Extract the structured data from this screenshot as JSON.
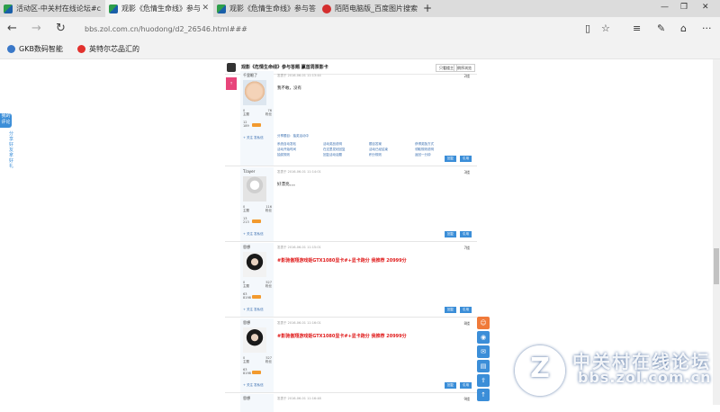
{
  "tabs": [
    {
      "label": "活动区-中关村在线论坛#c"
    },
    {
      "label": "观影《危情生命线》参与"
    },
    {
      "label": "观影《危情生命线》参与答"
    },
    {
      "label": "陌陌电脑版_百度图片搜索"
    }
  ],
  "address": {
    "url": "bbs.zol.com.cn/huodong/d2_26546.html###"
  },
  "favorites": [
    {
      "label": "GKB数码智能"
    },
    {
      "label": "英特尔芯品汇的"
    }
  ],
  "side_tab": {
    "top": "我的 评论",
    "text": "分享好友拿好礼"
  },
  "thread": {
    "title": "观影《危情生命线》参与答题 赢首周票影卡",
    "btn1": "只看楼主",
    "btn2": "倒序浏览"
  },
  "posts": [
    {
      "user": "千里眼了",
      "time": "发表于 2016-06-01 11:13:44",
      "floor": "2楼",
      "content": "我不敢，没有",
      "s1": "0",
      "s2": "76",
      "l1": "主题",
      "l2": "粉丝",
      "gold": "12",
      "exp": "189",
      "follow": "+ 关注",
      "msg": "发私信",
      "reply": "回复",
      "quote": "引用",
      "tips_title": "分享题目：抽奖活动中",
      "tips": [
        "系统自动发帖",
        "活动奖品说明",
        "题目答案",
        "获得奖励方式",
        "活动开始时间",
        "在这里发帖回复",
        "活动已经结束",
        "领取规则说明",
        "抽奖规则",
        "回复活动话题",
        "积分规则",
        "返回一分钟"
      ]
    },
    {
      "user": "T.layer",
      "time": "发表于 2016-06-01 11:14:01",
      "floor": "3楼",
      "content": "好漂亮。。。",
      "s1": "0",
      "s2": "116",
      "l1": "主题",
      "l2": "粉丝",
      "gold": "13",
      "exp": "213",
      "follow": "+ 关注",
      "msg": "发私信",
      "reply": "回复",
      "quote": "引用"
    },
    {
      "user": "思想",
      "time": "发表于 2016-06-01 11:15:01",
      "floor": "7楼",
      "content": "#影驰傲翔游戏姬GTX1080显卡#+显卡跑分 我推荐 20999分",
      "s1": "0",
      "s2": "527",
      "l1": "主题",
      "l2": "粉丝",
      "gold": "63",
      "exp": "8198",
      "follow": "+ 关注",
      "msg": "发私信",
      "reply": "回复",
      "quote": "引用"
    },
    {
      "user": "思想",
      "time": "发表于 2016-06-01 11:16:01",
      "floor": "8楼",
      "content": "#影驰傲翔游戏姬GTX1080显卡#+显卡跑分 我推荐 20999分",
      "s1": "0",
      "s2": "527",
      "l1": "主题",
      "l2": "粉丝",
      "gold": "63",
      "exp": "8198",
      "follow": "+ 关注",
      "msg": "发私信",
      "reply": "回复",
      "quote": "引用"
    },
    {
      "user": "思想",
      "time": "发表于 2016-06-01 11:16:48",
      "floor": "9楼"
    }
  ],
  "watermark": {
    "cn": "中关村在线论坛",
    "url": "bbs.zol.com.cn",
    "mark": "Z"
  }
}
